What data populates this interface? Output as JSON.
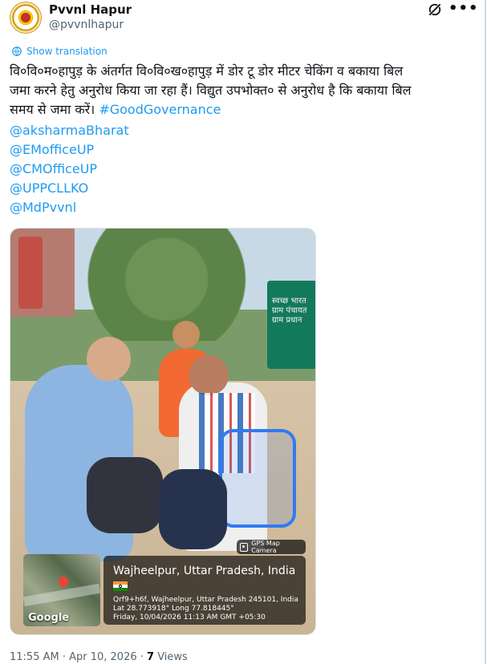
{
  "header": {
    "display_name": "Pvvnl Hapur",
    "handle": "@pvvnlhapur",
    "grok_icon": "grok-icon",
    "more_icon": "more-icon"
  },
  "translate_label": "Show translation",
  "tweet": {
    "line1": "वि०वि०म०हापुड़ के अंतर्गत वि०वि०ख०हापुड़ में डोर टू डोर मीटर चेकिंग व बकाया बिल",
    "line2": "जमा करने हेतु अनुरोध किया जा रहा हैं। विद्युत उपभोक्त० से अनुरोध है कि बकाया बिल",
    "line3": "समय से जमा करें।",
    "hashtag": "#GoodGovernance",
    "mentions": [
      "@aksharmaBharat",
      "@EMofficeUP",
      "@CMOfficeUP",
      "@UPPCLLKO",
      "@MdPvvnl"
    ]
  },
  "photo": {
    "machine_label": "स्वच्छ भारत ग्राम पंचायत ग्राम प्रधान",
    "gps_badge": "GPS Map Camera",
    "map_label": "Google",
    "location_title": "Wajheelpur, Uttar Pradesh, India",
    "address": "Qrf9+h6f, Wajheelpur, Uttar Pradesh 245101, India",
    "coords": "Lat 28.773918° Long 77.818445°",
    "datetime": "Friday, 10/04/2026 11:13 AM GMT +05:30"
  },
  "meta": {
    "time_date": "11:55 AM · Apr 10, 2026 · ",
    "views_count": "7",
    "views_label": " Views"
  },
  "colors": {
    "accent": "#1d9bf0",
    "text": "#0f1419",
    "secondary": "#536471"
  }
}
